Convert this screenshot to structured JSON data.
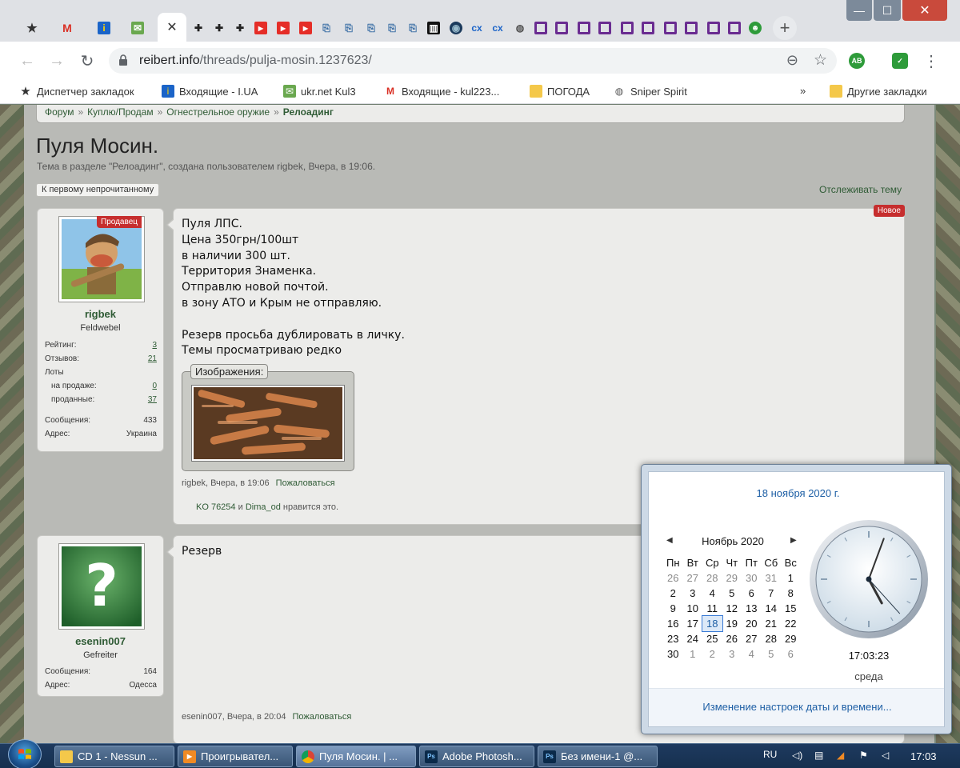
{
  "browser": {
    "active_tab_close": "✕",
    "new_tab": "+",
    "url_host": "reibert.info",
    "url_path": "/threads/pulja-mosin.1237623/",
    "window_controls": {
      "minimize": "—",
      "maximize": "☐",
      "close": "✕"
    },
    "extension_ab": "AB",
    "bookmarks": [
      {
        "label": "Диспетчер закладок",
        "icon": "star-icon"
      },
      {
        "label": "Входящие - I.UA",
        "icon": "iua-icon"
      },
      {
        "label": "ukr.net  Kul3",
        "icon": "ukrnet-icon"
      },
      {
        "label": "Входящие - kul223...",
        "icon": "gmail-icon"
      },
      {
        "label": "ПОГОДА",
        "icon": "folder-icon"
      },
      {
        "label": "Sniper Spirit",
        "icon": "globe-icon"
      }
    ],
    "more_bookmarks": "»",
    "other_bookmarks": "Другие закладки"
  },
  "breadcrumb": {
    "items": [
      "Форум",
      "Куплю/Продам",
      "Огнестрельное оружие"
    ],
    "current": "Релоадинг",
    "separator": "»"
  },
  "thread": {
    "title": "Пуля Мосин.",
    "meta": "Тема в разделе \"Релоадинг\", создана пользователем rigbek, Вчера, в 19:06.",
    "first_unread": "К первому непрочитанному",
    "watch": "Отслеживать тему"
  },
  "posts": [
    {
      "user": {
        "name": "rigbek",
        "title": "Feldwebel",
        "badge": "Продавец",
        "stats": {
          "rating_label": "Рейтинг:",
          "rating": "3",
          "reviews_label": "Отзывов:",
          "reviews": "21",
          "lots_label": "Лоты",
          "on_sale_label": "на продаже:",
          "on_sale": "0",
          "sold_label": "проданные:",
          "sold": "37",
          "messages_label": "Сообщения:",
          "messages": "433",
          "address_label": "Адрес:",
          "address": "Украина"
        }
      },
      "badge_new": "Новое",
      "text": "Пуля ЛПС.\nЦена 350грн/100шт\nв наличии 300 шт.\nТерритория Знаменка.\nОтправлю новой почтой.\nв зону АТО и Крым не отправляю.\n\nРезерв просьба дублировать в личку.\nТемы просматриваю редко",
      "attachments_label": "Изображения:",
      "meta": "rigbek, Вчера, в 19:06",
      "report": "Пожаловаться",
      "likes": {
        "user1": "KO 76254",
        "and": "и",
        "user2": "Dima_od",
        "suffix": "нравится это."
      }
    },
    {
      "user": {
        "name": "esenin007",
        "title": "Gefreiter",
        "stats": {
          "messages_label": "Сообщения:",
          "messages": "164",
          "address_label": "Адрес:",
          "address": "Одесса"
        }
      },
      "text": "Резерв",
      "meta": "esenin007, Вчера, в 20:04",
      "report": "Пожаловаться"
    }
  ],
  "calendar": {
    "date_long": "18 ноября 2020 г.",
    "month": "Ноябрь 2020",
    "prev": "◀",
    "next": "▶",
    "weekdays": [
      "Пн",
      "Вт",
      "Ср",
      "Чт",
      "Пт",
      "Сб",
      "Вс"
    ],
    "weeks": [
      [
        "26",
        "27",
        "28",
        "29",
        "30",
        "31",
        "1"
      ],
      [
        "2",
        "3",
        "4",
        "5",
        "6",
        "7",
        "8"
      ],
      [
        "9",
        "10",
        "11",
        "12",
        "13",
        "14",
        "15"
      ],
      [
        "16",
        "17",
        "18",
        "19",
        "20",
        "21",
        "22"
      ],
      [
        "23",
        "24",
        "25",
        "26",
        "27",
        "28",
        "29"
      ],
      [
        "30",
        "1",
        "2",
        "3",
        "4",
        "5",
        "6"
      ]
    ],
    "today": "18",
    "time": "17:03:23",
    "weekday": "среда",
    "change_link": "Изменение настроек даты и времени..."
  },
  "taskbar": {
    "tasks": [
      {
        "label": "CD 1 - Nessun ...",
        "icon": "folder-icon"
      },
      {
        "label": "Проигрывател...",
        "icon": "player-icon"
      },
      {
        "label": "Пуля Мосин. | ...",
        "icon": "chrome-icon"
      },
      {
        "label": "Adobe Photosh...",
        "icon": "photoshop-icon"
      },
      {
        "label": "Без имени-1 @...",
        "icon": "photoshop-icon"
      }
    ],
    "lang": "RU",
    "time": "17:03"
  }
}
